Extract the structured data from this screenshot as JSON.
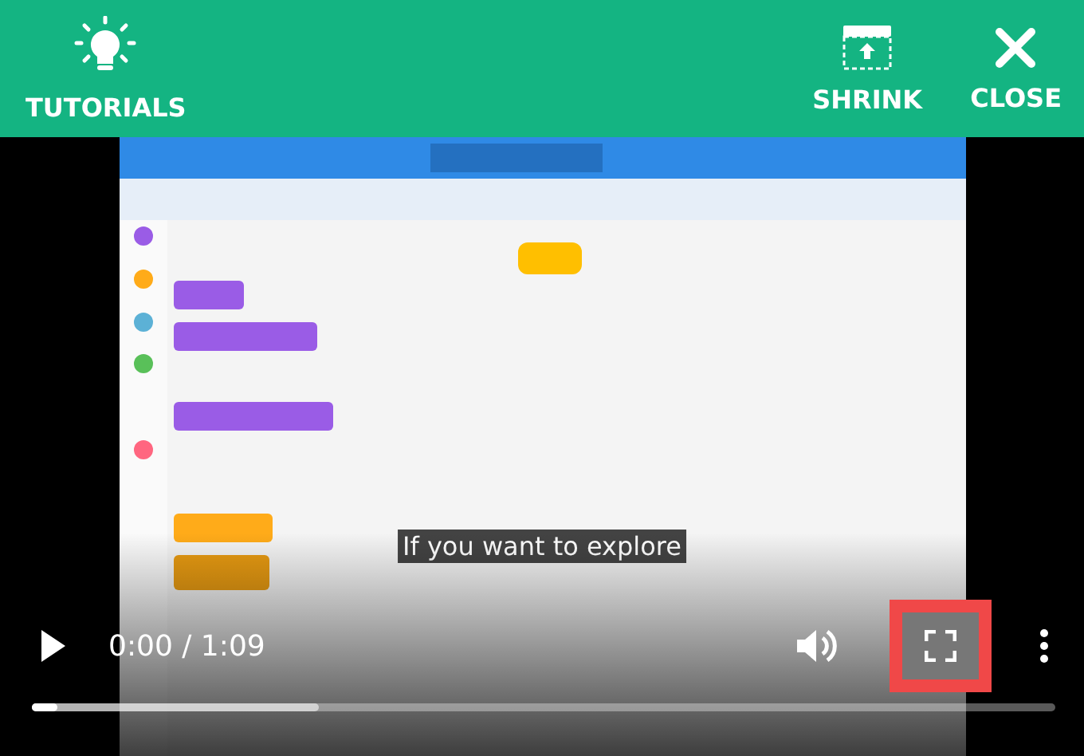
{
  "header": {
    "actions": [
      {
        "kind": "tutorials",
        "label": "TUTORIALS"
      },
      {
        "kind": "shrink",
        "label": "SHRINK"
      },
      {
        "kind": "close",
        "label": "CLOSE"
      }
    ]
  },
  "video": {
    "kind": "picture",
    "caption": "If you want to explore"
  },
  "controls": {
    "playing": false,
    "time": "0:00 / 1:09",
    "fullscreen_highlighted": true,
    "progress": {
      "level": 0.025
    },
    "buffered": {
      "level": 0.28
    }
  }
}
